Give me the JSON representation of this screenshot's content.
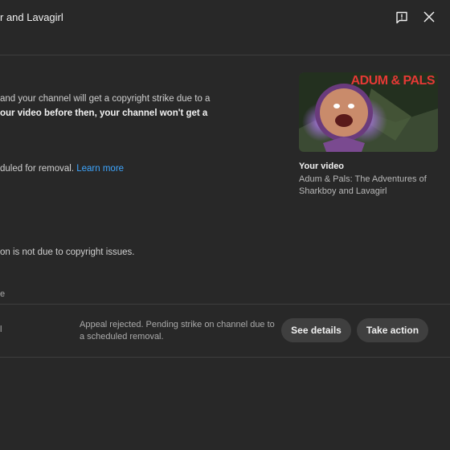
{
  "header": {
    "title": "r and Lavagirl",
    "feedback_icon": "feedback-icon",
    "close_icon": "close-icon"
  },
  "main": {
    "line1": "and your channel will get a copyright strike due to a",
    "line2": "our video before then, your channel won't get a",
    "line3": "",
    "scheduled_text": "duled for removal.",
    "learn_more": "Learn more",
    "not_copyright": "on is not due to copyright issues."
  },
  "video": {
    "heading": "Your video",
    "title": "Adum & Pals: The Adventures of Sharkboy and Lavagirl",
    "thumbnail_text": "ADUM & PALS"
  },
  "table": {
    "column_header": "e",
    "row": {
      "name_fragment": "l",
      "status": "Appeal rejected. Pending strike on channel due to a scheduled removal.",
      "see_details": "See details",
      "take_action": "Take action"
    }
  },
  "colors": {
    "background": "#282828",
    "link": "#3ea6ff",
    "pill": "#3f3f3f",
    "thumbnail_text": "#e53935"
  }
}
